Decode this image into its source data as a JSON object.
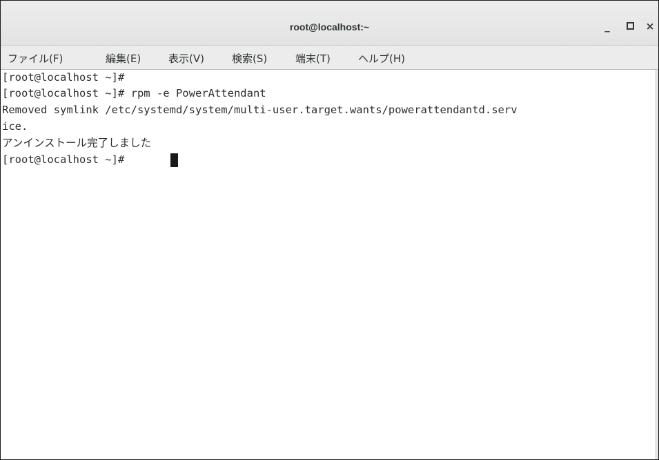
{
  "window": {
    "title": "root@localhost:~",
    "controls": {
      "minimize": "_",
      "close": "×"
    }
  },
  "menubar": {
    "items": [
      "ファイル(F)",
      "編集(E)",
      "表示(V)",
      "検索(S)",
      "端末(T)",
      "ヘルプ(H)"
    ]
  },
  "terminal": {
    "lines": [
      "[root@localhost ~]#",
      "[root@localhost ~]# rpm -e PowerAttendant",
      "Removed symlink /etc/systemd/system/multi-user.target.wants/powerattendantd.serv",
      "ice.",
      "アンインストール完了しました",
      "[root@localhost ~]# "
    ]
  },
  "colors": {
    "titlebar": "#e6e6e6",
    "menubar": "#ececec",
    "terminal_bg": "#ffffff",
    "terminal_fg": "#2e2e2e",
    "cursor": "#1a1a1a"
  }
}
